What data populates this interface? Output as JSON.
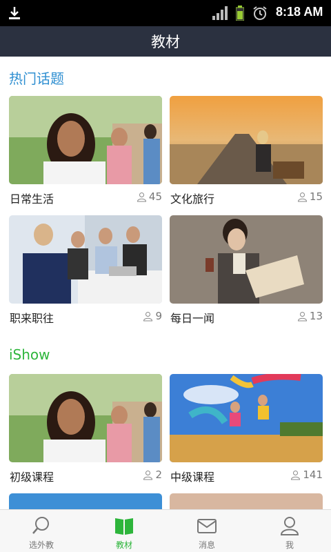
{
  "status_bar": {
    "time": "8:18 AM"
  },
  "header": {
    "title": "教材"
  },
  "sections": [
    {
      "title": "热门话题",
      "color": "#2f8fd1",
      "cards": [
        {
          "label": "日常生活",
          "count": "45"
        },
        {
          "label": "文化旅行",
          "count": "15"
        },
        {
          "label": "职来职往",
          "count": "9"
        },
        {
          "label": "每日一闻",
          "count": "13"
        }
      ]
    },
    {
      "title": "iShow",
      "color": "#2db53b",
      "cards": [
        {
          "label": "初级课程",
          "count": "2"
        },
        {
          "label": "中级课程",
          "count": "141"
        }
      ]
    }
  ],
  "tabs": [
    {
      "label": "选外教",
      "icon": "search-icon"
    },
    {
      "label": "教材",
      "icon": "book-icon",
      "active": true
    },
    {
      "label": "消息",
      "icon": "mail-icon"
    },
    {
      "label": "我",
      "icon": "person-icon"
    }
  ]
}
